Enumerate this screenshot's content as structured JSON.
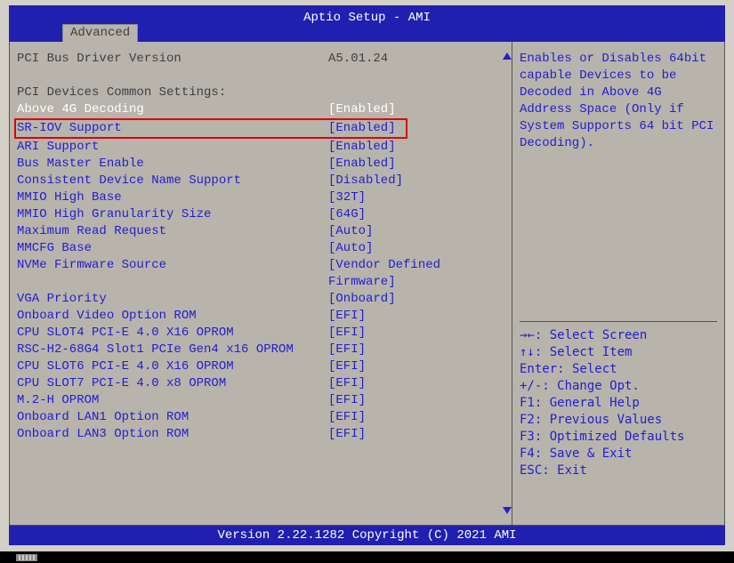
{
  "header": {
    "title": "Aptio Setup - AMI",
    "tab": "Advanced"
  },
  "static_rows": [
    {
      "label": "PCI Bus Driver Version",
      "value": "A5.01.24"
    }
  ],
  "settings_header": "PCI Devices Common Settings:",
  "highlighted_row": {
    "label": "Above 4G Decoding",
    "value": "[Enabled]"
  },
  "boxed_row": {
    "label": "SR-IOV Support",
    "value": "[Enabled]"
  },
  "option_rows": [
    {
      "label": "ARI Support",
      "value": "[Enabled]"
    },
    {
      "label": "Bus Master Enable",
      "value": "[Enabled]"
    },
    {
      "label": "Consistent Device Name Support",
      "value": "[Disabled]"
    },
    {
      "label": "MMIO High Base",
      "value": "[32T]"
    },
    {
      "label": "MMIO High Granularity Size",
      "value": "[64G]"
    },
    {
      "label": "Maximum Read Request",
      "value": "[Auto]"
    },
    {
      "label": "MMCFG Base",
      "value": "[Auto]"
    },
    {
      "label": "NVMe Firmware Source",
      "value": "[Vendor Defined"
    },
    {
      "label": "",
      "value": "Firmware]"
    },
    {
      "label": "VGA Priority",
      "value": "[Onboard]"
    },
    {
      "label": "Onboard Video Option ROM",
      "value": "[EFI]"
    },
    {
      "label": "CPU SLOT4 PCI-E 4.0 X16 OPROM",
      "value": "[EFI]"
    },
    {
      "label": "RSC-H2-68G4 Slot1 PCIe Gen4 x16 OPROM",
      "value": "[EFI]"
    },
    {
      "label": "CPU SLOT6 PCI-E 4.0 X16 OPROM",
      "value": "[EFI]"
    },
    {
      "label": "CPU SLOT7 PCI-E 4.0 x8 OPROM",
      "value": "[EFI]"
    },
    {
      "label": "M.2-H OPROM",
      "value": "[EFI]"
    },
    {
      "label": "Onboard LAN1 Option ROM",
      "value": "[EFI]"
    },
    {
      "label": "Onboard LAN3 Option ROM",
      "value": "[EFI]"
    }
  ],
  "help": {
    "text": "Enables or Disables 64bit capable Devices to be Decoded in Above 4G Address Space (Only if System Supports 64 bit PCI Decoding).",
    "keys": [
      "→←: Select Screen",
      "↑↓: Select Item",
      "Enter: Select",
      "+/-: Change Opt.",
      "F1: General Help",
      "F2: Previous Values",
      "F3: Optimized Defaults",
      "F4: Save & Exit",
      "ESC: Exit"
    ]
  },
  "footer": "Version 2.22.1282 Copyright (C) 2021 AMI"
}
